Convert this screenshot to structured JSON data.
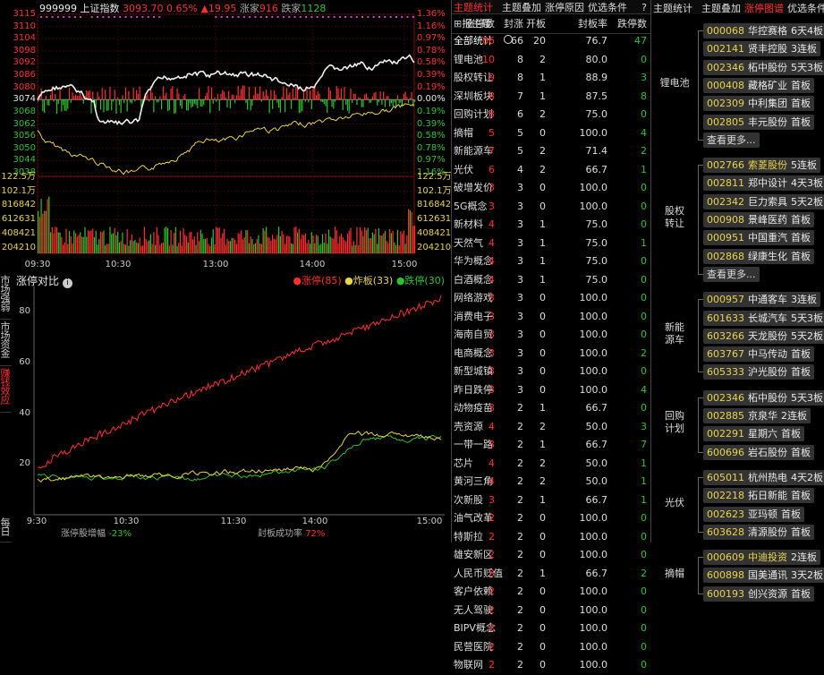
{
  "index_header": {
    "code": "999999",
    "name": "上证指数",
    "price": "3093.70",
    "pct": "0.65%",
    "change": "▲19.95",
    "rise_label": "涨家",
    "rise": "916",
    "fall_label": "跌家",
    "fall": "1128"
  },
  "price_axis": [
    "3115",
    "3110",
    "3104",
    "3098",
    "3092",
    "3086",
    "3080",
    "3074",
    "3068",
    "3062",
    "3056",
    "3050",
    "3044",
    "3038"
  ],
  "pct_axis": [
    "1.36%",
    "1.16%",
    "0.97%",
    "0.78%",
    "0.58%",
    "0.39%",
    "0.19%",
    "0.00%",
    "0.19%",
    "0.39%",
    "0.58%",
    "0.78%",
    "0.97%",
    "1.16%"
  ],
  "volume_axis_left": [
    "122.5万",
    "102.1万",
    "816842",
    "612631",
    "408421",
    "204210"
  ],
  "volume_axis_right": [
    "122.5万",
    "102.1万",
    "816842",
    "612631",
    "408421",
    "204210"
  ],
  "time_axis": [
    "09:30",
    "10:30",
    "13:00",
    "14:00",
    "15:00"
  ],
  "lower_chart": {
    "title": "涨停对比",
    "legend": [
      {
        "label": "●涨停(85)",
        "color": "#ff3030"
      },
      {
        "label": "●炸板(33)",
        "color": "#e8d34a"
      },
      {
        "label": "●跌停(30)",
        "color": "#2fc22f"
      }
    ],
    "y_ticks": [
      "80",
      "60",
      "40",
      "20"
    ],
    "x_ticks": [
      "9:30",
      "10:30",
      "11:30",
      "14:00",
      "15:00"
    ],
    "footer": {
      "left_label": "涨停股增幅",
      "left_value": "-23%",
      "right_label": "封板成功率",
      "right_value": "72%"
    }
  },
  "side_tabs": [
    "市场强弱",
    "市场资金",
    "赚钱效应",
    "每日"
  ],
  "mid_panel": {
    "tabs": [
      "主题统计",
      "主题叠加",
      "涨停原因",
      "优选条件"
    ],
    "help": "?",
    "headers": [
      "报主题",
      "涨停数",
      "封涨",
      "开板",
      "封板率",
      "跌停数"
    ],
    "rows": [
      [
        "全部统计",
        "86",
        "66",
        "20",
        "76.7",
        "47"
      ],
      [
        "锂电池",
        "10",
        "8",
        "2",
        "80.0",
        "0"
      ],
      [
        "股权转让",
        "9",
        "8",
        "1",
        "88.9",
        "3"
      ],
      [
        "深圳板块",
        "8",
        "7",
        "1",
        "87.5",
        "8"
      ],
      [
        "回购计划",
        "8",
        "6",
        "2",
        "75.0",
        "0"
      ],
      [
        "摘帽",
        "5",
        "5",
        "0",
        "100.0",
        "4"
      ],
      [
        "新能源车",
        "7",
        "5",
        "2",
        "71.4",
        "2"
      ],
      [
        "光伏",
        "6",
        "4",
        "2",
        "66.7",
        "1"
      ],
      [
        "破增发价",
        "3",
        "3",
        "0",
        "100.0",
        "0"
      ],
      [
        "5G概念",
        "3",
        "3",
        "0",
        "100.0",
        "0"
      ],
      [
        "新材料",
        "4",
        "3",
        "1",
        "75.0",
        "0"
      ],
      [
        "天然气",
        "4",
        "3",
        "1",
        "75.0",
        "1"
      ],
      [
        "华为概念",
        "4",
        "3",
        "1",
        "75.0",
        "0"
      ],
      [
        "白酒概念",
        "4",
        "3",
        "1",
        "75.0",
        "0"
      ],
      [
        "网络游戏",
        "3",
        "3",
        "0",
        "100.0",
        "0"
      ],
      [
        "消费电子",
        "3",
        "3",
        "0",
        "100.0",
        "0"
      ],
      [
        "海南自贸",
        "3",
        "3",
        "0",
        "100.0",
        "0"
      ],
      [
        "电商概念",
        "3",
        "3",
        "0",
        "100.0",
        "2"
      ],
      [
        "新型城镇",
        "3",
        "3",
        "0",
        "100.0",
        "0"
      ],
      [
        "昨日跌停",
        "3",
        "3",
        "0",
        "100.0",
        "4"
      ],
      [
        "动物疫苗",
        "3",
        "2",
        "1",
        "66.7",
        "0"
      ],
      [
        "壳资源",
        "4",
        "2",
        "2",
        "50.0",
        "3"
      ],
      [
        "一带一路",
        "3",
        "2",
        "1",
        "66.7",
        "7"
      ],
      [
        "芯片",
        "4",
        "2",
        "2",
        "50.0",
        "1"
      ],
      [
        "黄河三角",
        "4",
        "2",
        "2",
        "50.0",
        "1"
      ],
      [
        "次新股",
        "3",
        "2",
        "1",
        "66.7",
        "1"
      ],
      [
        "油气改革",
        "2",
        "2",
        "0",
        "100.0",
        "0"
      ],
      [
        "特斯拉",
        "2",
        "2",
        "0",
        "100.0",
        "0"
      ],
      [
        "雄安新区",
        "2",
        "2",
        "0",
        "100.0",
        "0"
      ],
      [
        "人民币贬值",
        "3",
        "2",
        "1",
        "66.7",
        "2"
      ],
      [
        "客户依赖",
        "2",
        "2",
        "0",
        "100.0",
        "0"
      ],
      [
        "无人驾驶",
        "2",
        "2",
        "0",
        "100.0",
        "0"
      ],
      [
        "BIPV概念",
        "2",
        "2",
        "0",
        "100.0",
        "0"
      ],
      [
        "民营医院",
        "2",
        "2",
        "0",
        "100.0",
        "0"
      ],
      [
        "物联网",
        "2",
        "2",
        "0",
        "100.0",
        "0"
      ]
    ]
  },
  "right_panel": {
    "tabs": [
      "主题统计",
      "主题叠加",
      "涨停图谱",
      "优选条件"
    ],
    "more_label": "查看更多...",
    "groups": [
      {
        "label": "锂电池",
        "items": [
          [
            "000068",
            "华控赛格",
            "6天4板",
            false
          ],
          [
            "002141",
            "贤丰控股",
            "3连板",
            false
          ],
          [
            "002346",
            "柘中股份",
            "5天3板",
            false
          ],
          [
            "000408",
            "藏格矿业",
            "首板",
            false
          ],
          [
            "002309",
            "中利集团",
            "首板",
            false
          ],
          [
            "002805",
            "丰元股份",
            "首板",
            false
          ]
        ],
        "more": true
      },
      {
        "label": "股权转让",
        "items": [
          [
            "002766",
            "索菱股份",
            "5连板",
            true
          ],
          [
            "002811",
            "郑中设计",
            "4天3板",
            false
          ],
          [
            "002342",
            "巨力索具",
            "5天2板",
            false
          ],
          [
            "000908",
            "景峰医药",
            "首板",
            false
          ],
          [
            "000951",
            "中国重汽",
            "首板",
            false
          ],
          [
            "002868",
            "绿康生化",
            "首板",
            false
          ]
        ],
        "more": true
      },
      {
        "label": "新能源车",
        "items": [
          [
            "000957",
            "中通客车",
            "3连板",
            false
          ],
          [
            "601633",
            "长城汽车",
            "5天3板",
            false
          ],
          [
            "603266",
            "天龙股份",
            "5天2板",
            false
          ],
          [
            "603767",
            "中马传动",
            "首板",
            false
          ],
          [
            "605333",
            "沪光股份",
            "首板",
            false
          ]
        ],
        "more": false
      },
      {
        "label": "回购计划",
        "items": [
          [
            "002346",
            "柘中股份",
            "5天3板",
            false
          ],
          [
            "002885",
            "京泉华",
            "2连板",
            false
          ],
          [
            "002291",
            "星期六",
            "首板",
            false
          ],
          [
            "600696",
            "岩石股份",
            "首板",
            false
          ]
        ],
        "more": false
      },
      {
        "label": "光伏",
        "items": [
          [
            "605011",
            "杭州热电",
            "4天2板",
            false
          ],
          [
            "002218",
            "拓日新能",
            "首板",
            false
          ],
          [
            "002623",
            "亚玛顿",
            "首板",
            false
          ],
          [
            "603628",
            "清源股份",
            "首板",
            false
          ]
        ],
        "more": false
      },
      {
        "label": "摘帽",
        "items": [
          [
            "000609",
            "中迪投资",
            "2连板",
            true
          ],
          [
            "600898",
            "国美通讯",
            "3天2板",
            false
          ],
          [
            "600193",
            "创兴资源",
            "首板",
            false
          ]
        ],
        "more": false
      }
    ]
  },
  "colors": {
    "up": "#ff3030",
    "down": "#2fc22f",
    "warn": "#e8d34a",
    "accent": "#e0d040"
  }
}
